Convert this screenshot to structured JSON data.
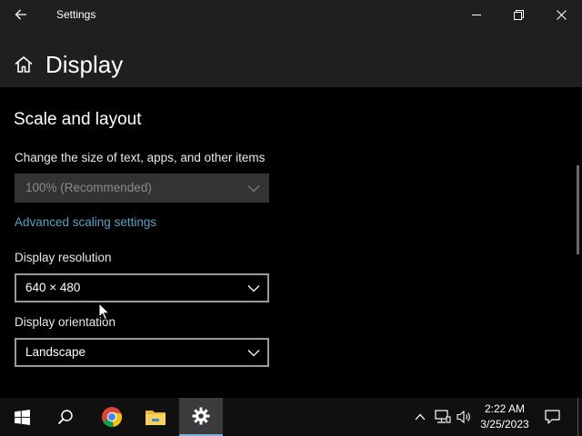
{
  "window": {
    "title": "Settings"
  },
  "header": {
    "title": "Display"
  },
  "section": {
    "title": "Scale and layout"
  },
  "scale": {
    "label": "Change the size of text, apps, and other items",
    "value": "100% (Recommended)"
  },
  "advanced_link": "Advanced scaling settings",
  "resolution": {
    "label": "Display resolution",
    "value": "640 × 480"
  },
  "orientation": {
    "label": "Display orientation",
    "value": "Landscape"
  },
  "taskbar": {
    "apps": [
      "windows-start-icon",
      "search-icon",
      "chrome-icon",
      "file-explorer-icon",
      "settings-icon"
    ],
    "clock": {
      "time": "2:22 AM",
      "date": "3/25/2023"
    }
  },
  "colors": {
    "accent_link": "#4fa3c7",
    "titlebar": "#1f1f1f",
    "taskbar": "#101010"
  }
}
